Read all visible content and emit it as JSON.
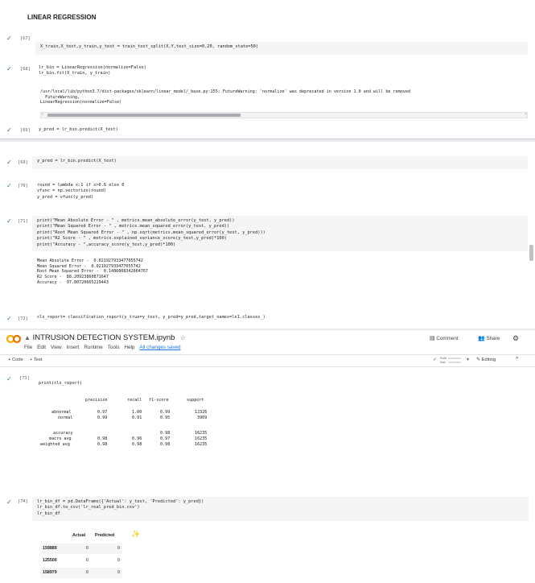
{
  "panel1": {
    "heading": "LINEAR REGRESSION",
    "cell67": {
      "prompt": "[67]",
      "code": "X_train,X_test,y_train,y_test = train_test_split(X,Y,test_size=0.20, random_state=50)"
    },
    "cell68": {
      "prompt": "[68]",
      "code_l1": "lr_bin = LinearRegression(normalize=False)",
      "code_l2": "lr_bin.fit(X_train, y_train)",
      "out_l1": "/usr/local/lib/python3.7/dist-packages/sklearn/linear_model/_base.py:155: FutureWarning: 'normalize' was deprecated in version 1.0 and will be removed",
      "out_l2": "  FutureWarning,",
      "out_l3": "LinearRegression(normalize=False)"
    },
    "cell69": {
      "prompt": "[69]",
      "code": "y_pred = lr_bin.predict(X_test)"
    }
  },
  "panel2": {
    "cell69": {
      "prompt": "[69]",
      "code": "y_pred = lr_bin.predict(X_test)"
    },
    "cell70": {
      "prompt": "[70]",
      "code_l1": "round = lambda x:1 if x>0.6 else 0",
      "code_l2": "vfunc = np.vectorize(round)",
      "code_l3": "y_pred = vfunc(y_pred)"
    },
    "cell71": {
      "prompt": "[71]",
      "code_l1": "print(\"Mean Absolute Error - \" , metrics.mean_absolute_error(y_test, y_pred))",
      "code_l2": "print(\"Mean Squared Error - \" , metrics.mean_squared_error(y_test, y_pred))",
      "code_l3": "print(\"Root Mean Squared Error - \" , np.sqrt(metrics.mean_squared_error(y_test, y_pred)))",
      "code_l4": "print(\"R2 Score - \" , metrics.explained_variance_score(y_test,y_pred)*100)",
      "code_l5": "print(\"Accuracy - \",accuracy_score(y_test,y_pred)*100)",
      "out_l1": "Mean Absolute Error -  0.021927933477055742",
      "out_l2": "Mean Squared Error -  0.021927933477055742",
      "out_l3": "Root Mean Squared Error -  0.1480808342664767",
      "out_l4": "R2 Score -  88.20923860871647",
      "out_l5": "Accuracy -  97.80720665229443"
    },
    "cell72": {
      "prompt": "[72]",
      "code": "cls_report= classification_report(y_true=y_test, y_pred=y_pred,target_names=le1.classes_)"
    }
  },
  "colab": {
    "title": "INTRUSION DETECTION SYSTEM.ipynb",
    "star": "☆",
    "menu": [
      "File",
      "Edit",
      "View",
      "Insert",
      "Runtime",
      "Tools",
      "Help"
    ],
    "changes": "All changes saved",
    "comment": "Comment",
    "share": "Share",
    "add_code": "+ Code",
    "add_text": "+ Text",
    "ram": "RAM",
    "disk": "Disk",
    "editing": "Editing",
    "cell73": {
      "prompt": "[73]",
      "code": "print(cls_report)",
      "report_header": [
        "precision",
        "recall",
        "f1-score",
        "support"
      ],
      "report_rows": [
        {
          "label": "abnormal",
          "precision": "0.97",
          "recall": "1.00",
          "f1": "0.99",
          "support": "12326"
        },
        {
          "label": "normal",
          "precision": "0.99",
          "recall": "0.91",
          "f1": "0.95",
          "support": "3909"
        }
      ],
      "report_summary": [
        {
          "label": "accuracy",
          "precision": "",
          "recall": "",
          "f1": "0.98",
          "support": "16235"
        },
        {
          "label": "macro avg",
          "precision": "0.98",
          "recall": "0.96",
          "f1": "0.97",
          "support": "16235"
        },
        {
          "label": "weighted avg",
          "precision": "0.98",
          "recall": "0.98",
          "f1": "0.98",
          "support": "16235"
        }
      ]
    },
    "cell74": {
      "prompt": "[74]",
      "code_l1": "lr_bin_df = pd.DataFrame({'Actual': y_test, 'Predicted': y_pred})",
      "code_l2": "lr_bin_df.to_csv('lr_real_pred_bin.csv')",
      "code_l3": "lr_bin_df",
      "df_cols": [
        "Actual",
        "Predicted"
      ],
      "df_rows": [
        {
          "idx": "159889",
          "actual": "0",
          "pred": "0"
        },
        {
          "idx": "125506",
          "actual": "0",
          "pred": "0"
        },
        {
          "idx": "158979",
          "actual": "0",
          "pred": "0"
        }
      ]
    }
  },
  "colors": {
    "check": "#2e7d32",
    "link": "#1a73e8",
    "code_bg": "#f5f5f5",
    "colab_orange": "#f9ab00"
  }
}
